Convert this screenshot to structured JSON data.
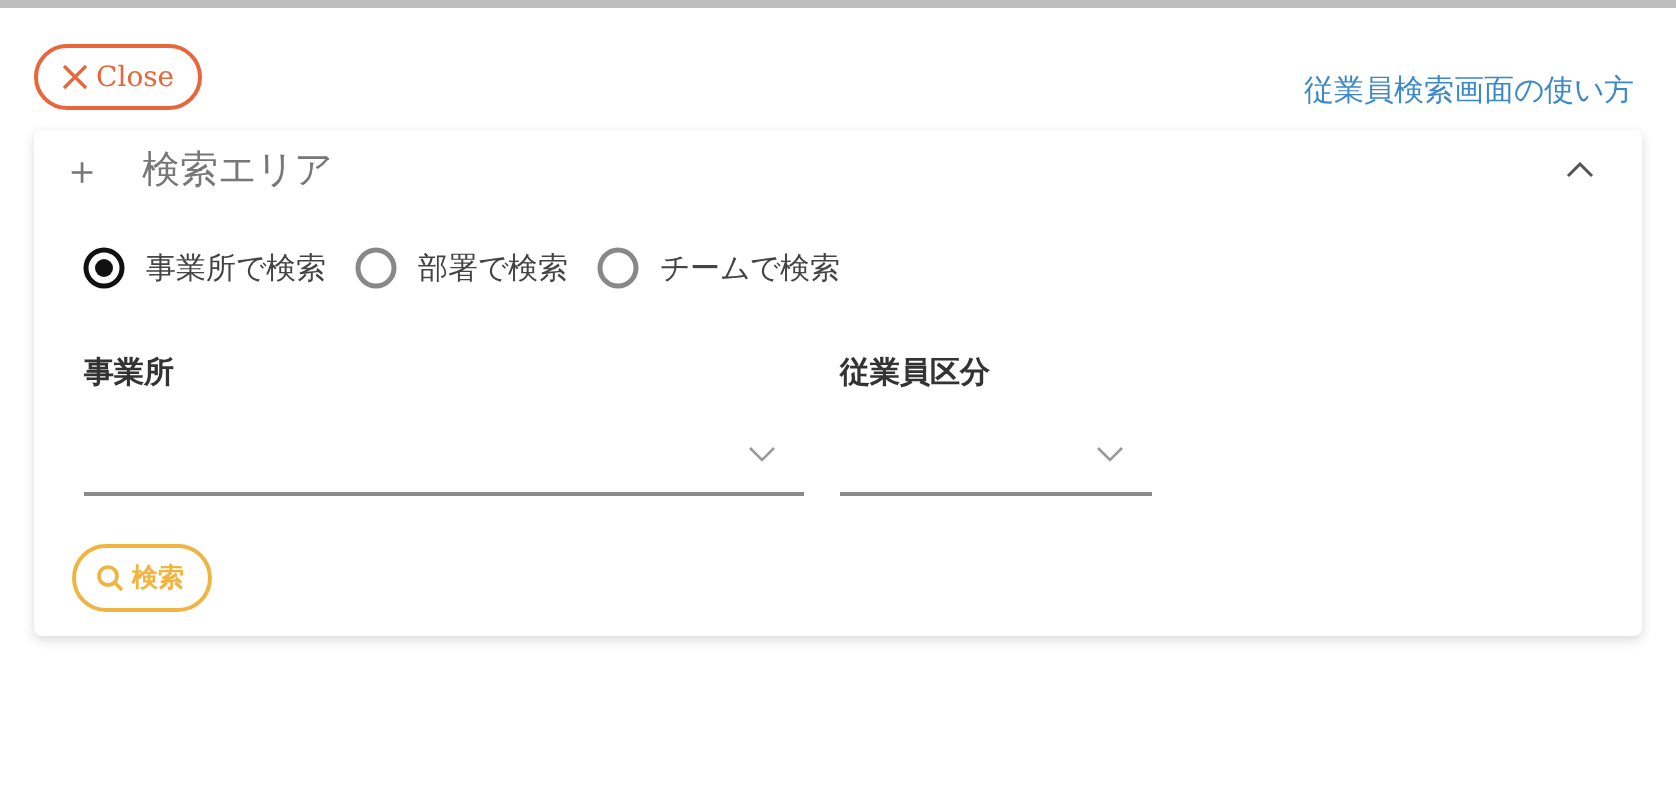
{
  "close_button": {
    "label": "Close"
  },
  "help_link": {
    "label": "従業員検索画面の使い方"
  },
  "search_area": {
    "icon": "＋",
    "title": "検索エリア",
    "expanded": true,
    "modes": [
      {
        "label": "事業所で検索",
        "selected": true
      },
      {
        "label": "部署で検索",
        "selected": false
      },
      {
        "label": "チームで検索",
        "selected": false
      }
    ],
    "fields": [
      {
        "label": "事業所",
        "kind": "wide"
      },
      {
        "label": "従業員区分",
        "kind": "narrow"
      }
    ],
    "search_button": {
      "label": "検索"
    }
  }
}
